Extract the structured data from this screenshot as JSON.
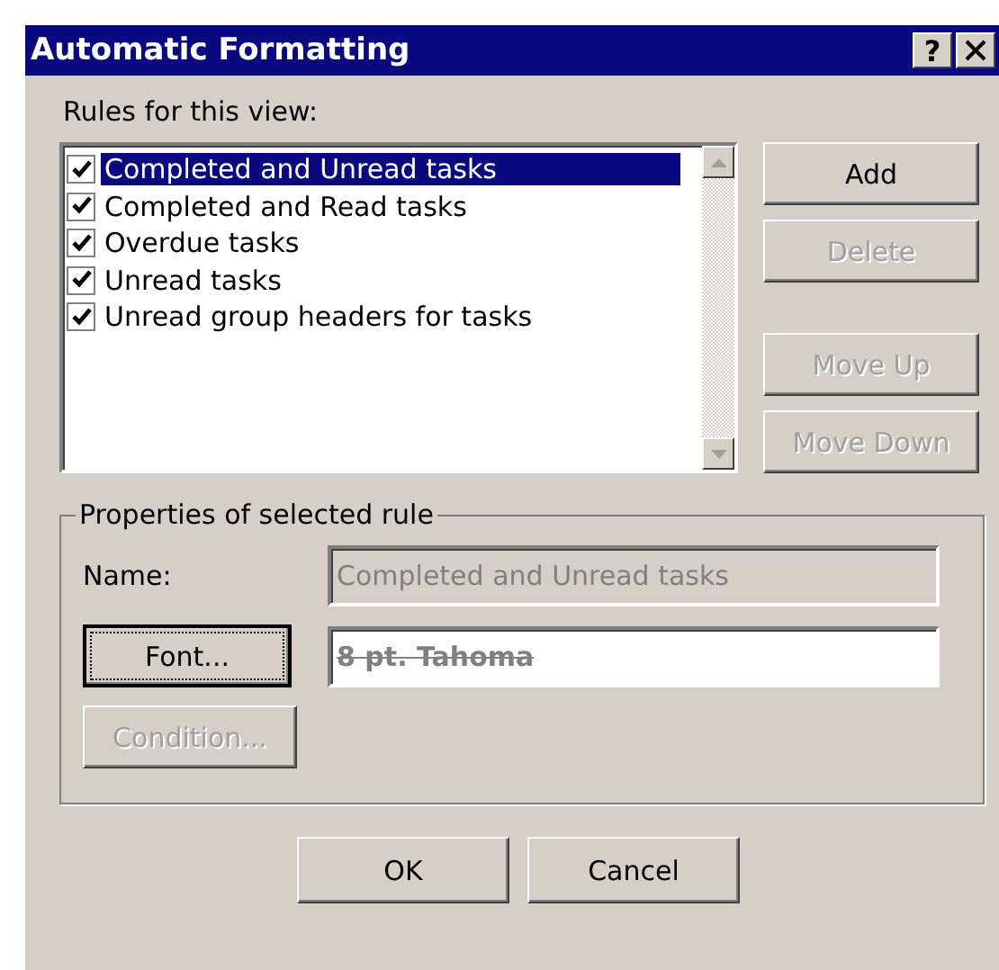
{
  "window": {
    "title": "Automatic Formatting",
    "help_button": "?"
  },
  "rules_label": "Rules for this view:",
  "rules": [
    {
      "label": "Completed and Unread tasks",
      "checked": true,
      "selected": true
    },
    {
      "label": "Completed and Read tasks",
      "checked": true,
      "selected": false
    },
    {
      "label": "Overdue tasks",
      "checked": true,
      "selected": false
    },
    {
      "label": "Unread tasks",
      "checked": true,
      "selected": false
    },
    {
      "label": "Unread group headers for tasks",
      "checked": true,
      "selected": false
    }
  ],
  "side_buttons": [
    {
      "label": "Add",
      "disabled": false
    },
    {
      "label": "Delete",
      "disabled": true
    },
    {
      "label": "Move Up",
      "disabled": true
    },
    {
      "label": "Move Down",
      "disabled": true
    }
  ],
  "properties": {
    "title": "Properties of selected rule",
    "name_label": "Name:",
    "name_value": "Completed and Unread tasks",
    "name_disabled": true,
    "font_button": {
      "label": "Font...",
      "disabled": false,
      "focused": true
    },
    "font_preview": "8 pt. Tahoma",
    "condition_button": {
      "label": "Condition...",
      "disabled": true,
      "focused": false
    }
  },
  "footer_buttons": [
    {
      "label": "OK"
    },
    {
      "label": "Cancel"
    }
  ]
}
